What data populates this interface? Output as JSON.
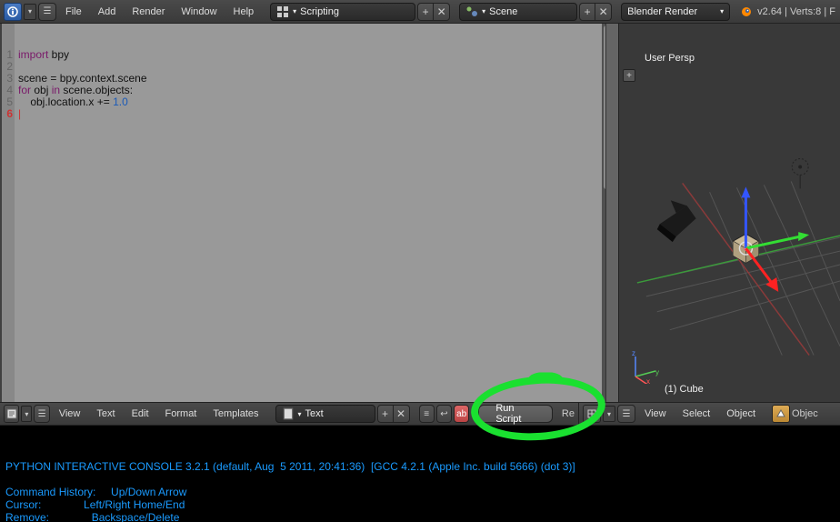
{
  "top_menu": {
    "items": [
      "File",
      "Add",
      "Render",
      "Window",
      "Help"
    ]
  },
  "layout_selector": {
    "label": "Scripting"
  },
  "scene_selector": {
    "label": "Scene"
  },
  "render_engine": {
    "label": "Blender Render"
  },
  "version": "v2.64 | Verts:8 | F",
  "text_editor": {
    "menu": [
      "View",
      "Text",
      "Edit",
      "Format",
      "Templates"
    ],
    "datablock_name": "Text",
    "run_button": "Run Script",
    "register_label": "Re",
    "line_numbers": [
      "1",
      "2",
      "3",
      "4",
      "5",
      "6"
    ],
    "code_lines": [
      {
        "tokens": [
          {
            "t": "import",
            "c": "kw"
          },
          {
            "t": " bpy",
            "c": ""
          }
        ]
      },
      {
        "tokens": []
      },
      {
        "tokens": [
          {
            "t": "scene = bpy.context.scene",
            "c": ""
          }
        ]
      },
      {
        "tokens": [
          {
            "t": "for",
            "c": "kw"
          },
          {
            "t": " obj ",
            "c": ""
          },
          {
            "t": "in",
            "c": "kw"
          },
          {
            "t": " scene.objects:",
            "c": ""
          }
        ]
      },
      {
        "tokens": [
          {
            "t": "    obj.location.x += ",
            "c": ""
          },
          {
            "t": "1.0",
            "c": "num"
          }
        ]
      },
      {
        "tokens": [
          {
            "t": "|",
            "c": "cursor-caret"
          }
        ]
      }
    ]
  },
  "viewport": {
    "menu": [
      "View",
      "Select",
      "Object"
    ],
    "label": "User Persp",
    "footer": "(1) Cube",
    "mode_label": "Objec"
  },
  "console": {
    "banner": "PYTHON INTERACTIVE CONSOLE 3.2.1 (default, Aug  5 2011, 20:41:36)  [GCC 4.2.1 (Apple Inc. build 5666) (dot 3)]",
    "help": [
      "Command History:     Up/Down Arrow",
      "Cursor:              Left/Right Home/End",
      "Remove:              Backspace/Delete"
    ]
  }
}
